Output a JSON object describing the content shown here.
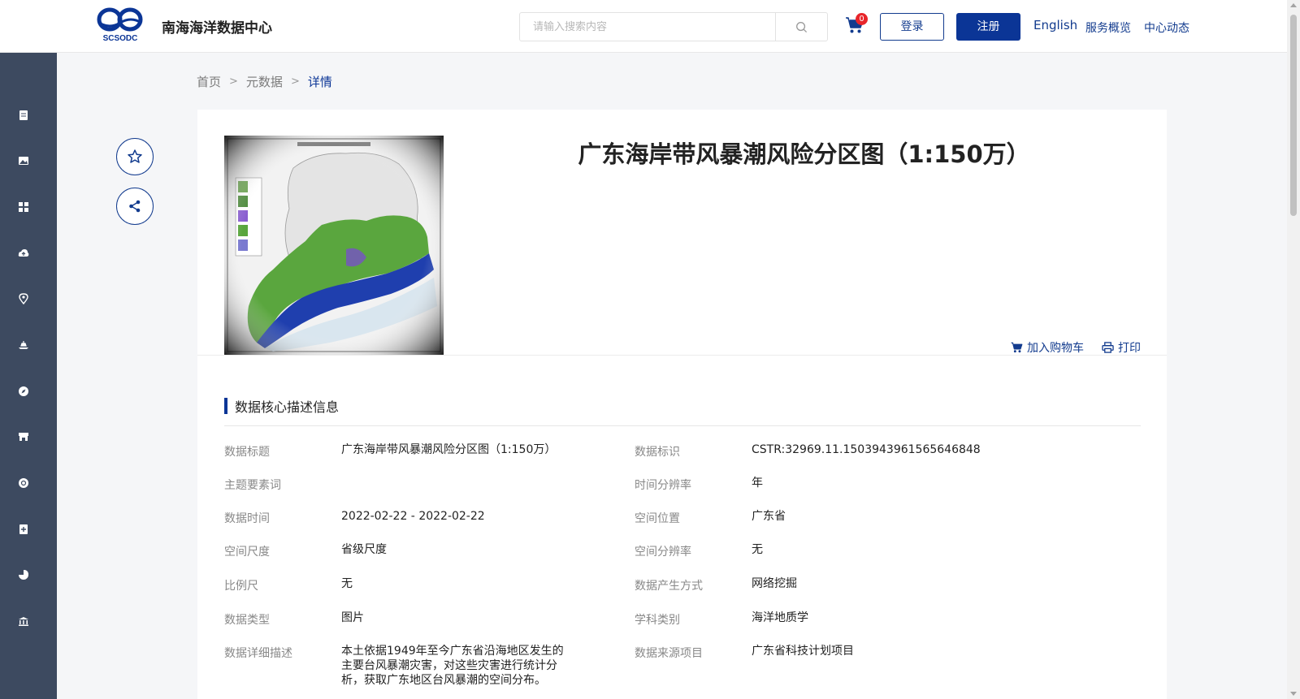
{
  "header": {
    "site_title": "南海海洋数据中心",
    "logo_text": "SCSODC",
    "search_placeholder": "请输入搜索内容",
    "cart_count": "0",
    "login": "登录",
    "register": "注册",
    "nav": {
      "english": "English",
      "overview": "服务概览",
      "news": "中心动态"
    },
    "colors": {
      "brand": "#0b3596",
      "sidebar": "#3d4a60",
      "badge": "#e8252a"
    }
  },
  "sidebar": {
    "icons": [
      "document-icon",
      "image-icon",
      "grid-icon",
      "cloud-upload-icon",
      "location-pin-icon",
      "ship-icon",
      "compass-icon",
      "store-icon",
      "globe-icon",
      "file-add-icon",
      "pie-chart-icon",
      "building-icon"
    ]
  },
  "breadcrumb": {
    "items": [
      "首页",
      "元数据",
      "详情"
    ]
  },
  "detail": {
    "title": "广东海岸带风暴潮风险分区图（1:150万）",
    "add_to_cart": "加入购物车",
    "print": "打印",
    "section_title": "数据核心描述信息",
    "fields_left": [
      {
        "label": "数据标题",
        "value": "广东海岸带风暴潮风险分区图（1:150万）"
      },
      {
        "label": "主题要素词",
        "value": ""
      },
      {
        "label": "数据时间",
        "value": "2022-02-22 - 2022-02-22"
      },
      {
        "label": "空间尺度",
        "value": "省级尺度"
      },
      {
        "label": "比例尺",
        "value": "无"
      },
      {
        "label": "数据类型",
        "value": "图片"
      },
      {
        "label": "数据详细描述",
        "value": "本土依据1949年至今广东省沿海地区发生的主要台风暴潮灾害，对这些灾害进行统计分析，获取广东地区台风暴潮的空间分布。"
      }
    ],
    "fields_right": [
      {
        "label": "数据标识",
        "value": "CSTR:32969.11.1503943961565646848"
      },
      {
        "label": "时间分辨率",
        "value": "年"
      },
      {
        "label": "空间位置",
        "value": "广东省"
      },
      {
        "label": "空间分辨率",
        "value": "无"
      },
      {
        "label": "数据产生方式",
        "value": "网络挖掘"
      },
      {
        "label": "学科类别",
        "value": "海洋地质学"
      },
      {
        "label": "数据来源项目",
        "value": "广东省科技计划项目"
      }
    ]
  }
}
